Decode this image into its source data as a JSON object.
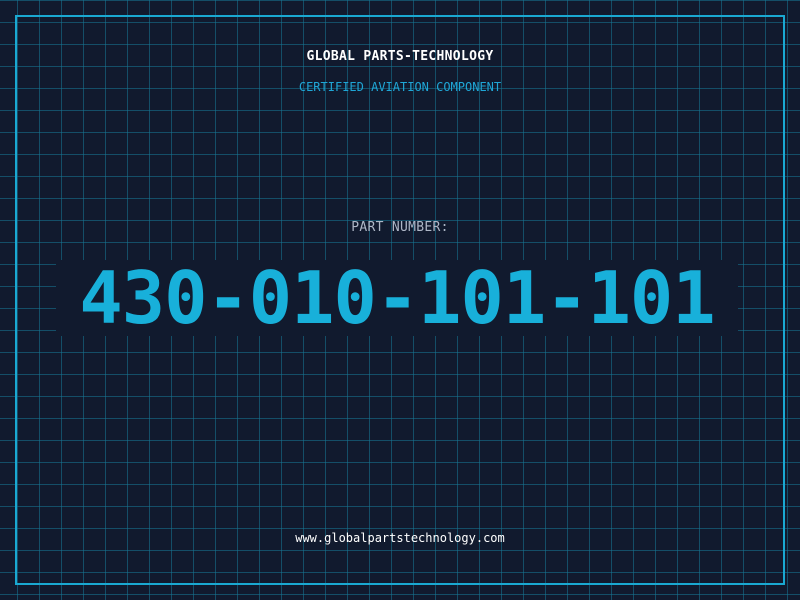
{
  "header": {
    "company": "GLOBAL PARTS-TECHNOLOGY",
    "tagline": "CERTIFIED AVIATION COMPONENT"
  },
  "part": {
    "label": "PART NUMBER:",
    "number": "430-010-101-101"
  },
  "footer": {
    "website": "www.globalpartstechnology.com"
  },
  "colors": {
    "background": "#111a2e",
    "accent": "#18b0da",
    "grid": "#1678a0",
    "text": "#ffffff"
  }
}
